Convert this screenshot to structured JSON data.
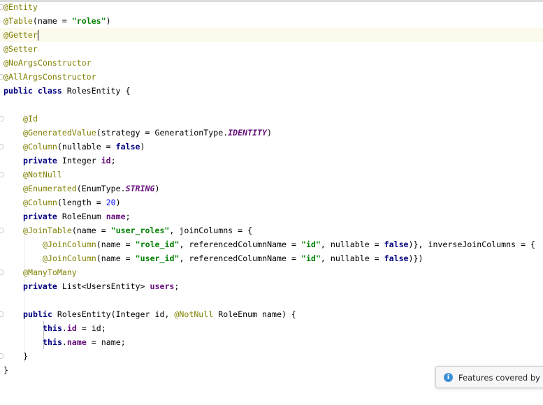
{
  "window": {
    "notification_text": "Features covered by Int"
  },
  "code": {
    "l1_ann": "@Entity",
    "l2_ann": "@Table",
    "l2_a": "(name = ",
    "l2_str": "\"roles\"",
    "l2_b": ")",
    "l3_ann": "@Getter",
    "l4_ann": "@Setter",
    "l5_ann": "@NoArgsConstructor",
    "l6_ann": "@AllArgsConstructor",
    "l7_kw1": "public",
    "l7_kw2": "class",
    "l7_rest": " RolesEntity {",
    "l9_ann": "@Id",
    "l10_ann": "@GeneratedValue",
    "l10_a": "(strategy = GenerationType.",
    "l10_const": "IDENTITY",
    "l10_b": ")",
    "l11_ann": "@Column",
    "l11_a": "(nullable = ",
    "l11_kw": "false",
    "l11_b": ")",
    "l12_kw": "private",
    "l12_a": " Integer ",
    "l12_field": "id",
    "l12_b": ";",
    "l13_ann": "@NotNull",
    "l14_ann": "@Enumerated",
    "l14_a": "(EnumType.",
    "l14_const": "STRING",
    "l14_b": ")",
    "l15_ann": "@Column",
    "l15_a": "(length = ",
    "l15_num": "20",
    "l15_b": ")",
    "l16_kw": "private",
    "l16_a": " RoleEnum ",
    "l16_field": "name",
    "l16_b": ";",
    "l17_ann": "@JoinTable",
    "l17_a": "(name = ",
    "l17_str": "\"user_roles\"",
    "l17_b": ", joinColumns = {",
    "l18_ann": "@JoinColumn",
    "l18_a": "(name = ",
    "l18_str1": "\"role_id\"",
    "l18_b": ", referencedColumnName = ",
    "l18_str2": "\"id\"",
    "l18_c": ", nullable = ",
    "l18_kw": "false",
    "l18_d": ")}, inverseJoinColumns = {",
    "l19_ann": "@JoinColumn",
    "l19_a": "(name = ",
    "l19_str1": "\"user_id\"",
    "l19_b": ", referencedColumnName = ",
    "l19_str2": "\"id\"",
    "l19_c": ", nullable = ",
    "l19_kw": "false",
    "l19_d": ")})",
    "l20_ann": "@ManyToMany",
    "l21_kw": "private",
    "l21_a": " List<UsersEntity> ",
    "l21_field": "users",
    "l21_b": ";",
    "l23_kw": "public",
    "l23_a": " RolesEntity(Integer id, ",
    "l23_ann": "@NotNull",
    "l23_b": " RoleEnum name) {",
    "l24_kw": "this",
    "l24_a": ".",
    "l24_field": "id",
    "l24_b": " = id;",
    "l25_kw": "this",
    "l25_a": ".",
    "l25_field": "name",
    "l25_b": " = name;",
    "l26": "}",
    "l27": "}"
  }
}
